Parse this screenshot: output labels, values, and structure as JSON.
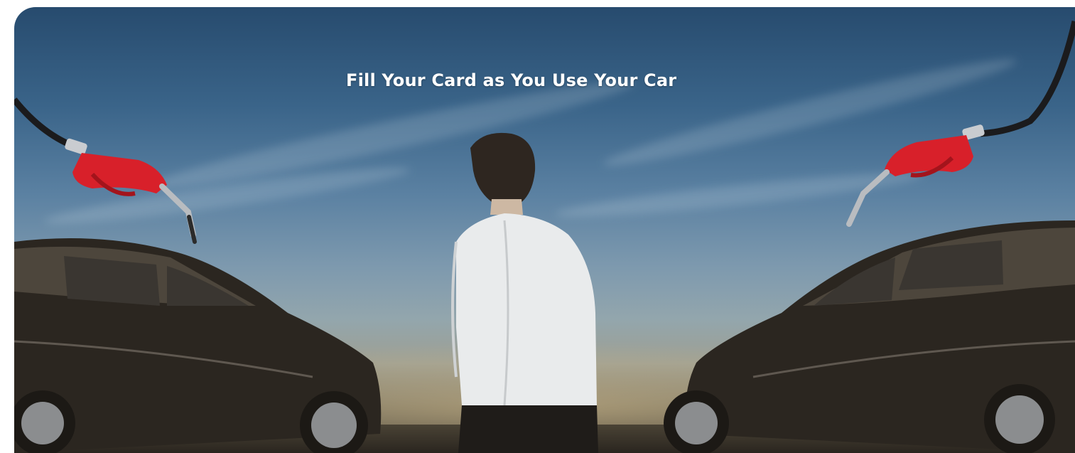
{
  "banner": {
    "headline": "Fill Your Card as You Use Your Car"
  },
  "illustration": {
    "left_nozzle": "fuel-nozzle-icon",
    "right_nozzle": "fuel-nozzle-icon",
    "left_car": "suv-car",
    "right_car": "suv-car",
    "person": "man-white-shirt",
    "colors": {
      "sky_top": "#274b6e",
      "sky_horizon": "#9e9f92",
      "nozzle_red": "#d8202a",
      "car_body": "#2b2620",
      "shirt": "#e9ebec"
    }
  }
}
